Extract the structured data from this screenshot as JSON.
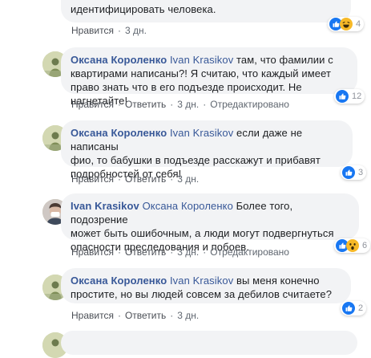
{
  "comments": [
    {
      "text_line1": "",
      "text_line2": "идентифицировать человека.",
      "like_label": "Нравится",
      "time": "3 дн.",
      "reaction_count": "4"
    },
    {
      "author": "Оксана Короленко",
      "mention": "Ivan Krasikov",
      "text_line1": " там, что фамилии с",
      "text_line2": "квартирами написаны?! Я считаю, что каждый имеет",
      "text_line3": "право знать что в его подъезде происходит. Не нагнетайте!",
      "like_label": "Нравится",
      "reply_label": "Ответить",
      "time": "3 дн.",
      "edited_label": "Отредактировано",
      "reaction_count": "12"
    },
    {
      "author": "Оксана Короленко",
      "mention": "Ivan Krasikov",
      "text_line1": " если даже не написаны",
      "text_line2": "фио, то бабушки в подъезде расскажут и прибавят",
      "text_line3": "подробностей от себя!",
      "like_label": "Нравится",
      "reply_label": "Ответить",
      "time": "3 дн.",
      "reaction_count": "3"
    },
    {
      "author": "Ivan Krasikov",
      "mention": "Оксана Короленко",
      "text_line1": " Более того, подозрение",
      "text_line2": "может быть ошибочным, а люди могут подвергнуться",
      "text_line3": "опасности преследования и побоев.",
      "like_label": "Нравится",
      "reply_label": "Ответить",
      "time": "3 дн.",
      "edited_label": "Отредактировано",
      "reaction_count": "6"
    },
    {
      "author": "Оксана Короленко",
      "mention": "Ivan Krasikov",
      "text_line1": " вы меня конечно",
      "text_line2": "простите, но вы людей совсем за дебилов считаете?",
      "like_label": "Нравится",
      "reply_label": "Ответить",
      "time": "3 дн.",
      "reaction_count": "2"
    }
  ],
  "colors": {
    "bubble": "#f2f3f5",
    "name": "#385898",
    "like_blue": "#1877f2",
    "haha_yellow": "#f7b928"
  },
  "icons": {
    "like": "thumbs-up-icon",
    "haha": "laughing-face-icon",
    "wow": "surprised-face-icon"
  }
}
